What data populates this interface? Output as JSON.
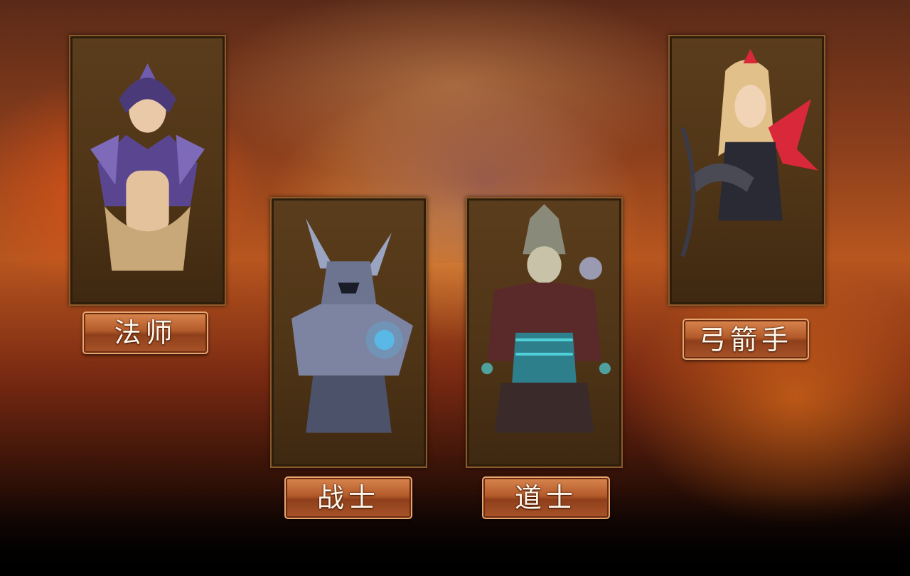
{
  "classes": [
    {
      "id": "mage",
      "label": "法师",
      "portrait_icon": "mage-portrait",
      "accent": "#6f5bb0"
    },
    {
      "id": "warrior",
      "label": "战士",
      "portrait_icon": "warrior-portrait",
      "accent": "#5ab8e6"
    },
    {
      "id": "taoist",
      "label": "道士",
      "portrait_icon": "taoist-portrait",
      "accent": "#4fd0d8"
    },
    {
      "id": "archer",
      "label": "弓箭手",
      "portrait_icon": "archer-portrait",
      "accent": "#d8283a"
    }
  ],
  "colors": {
    "card_bg": "#4e3416",
    "card_border": "#8a5a2a",
    "button_bg": "#b35a2a",
    "button_text": "#fff6ea"
  }
}
